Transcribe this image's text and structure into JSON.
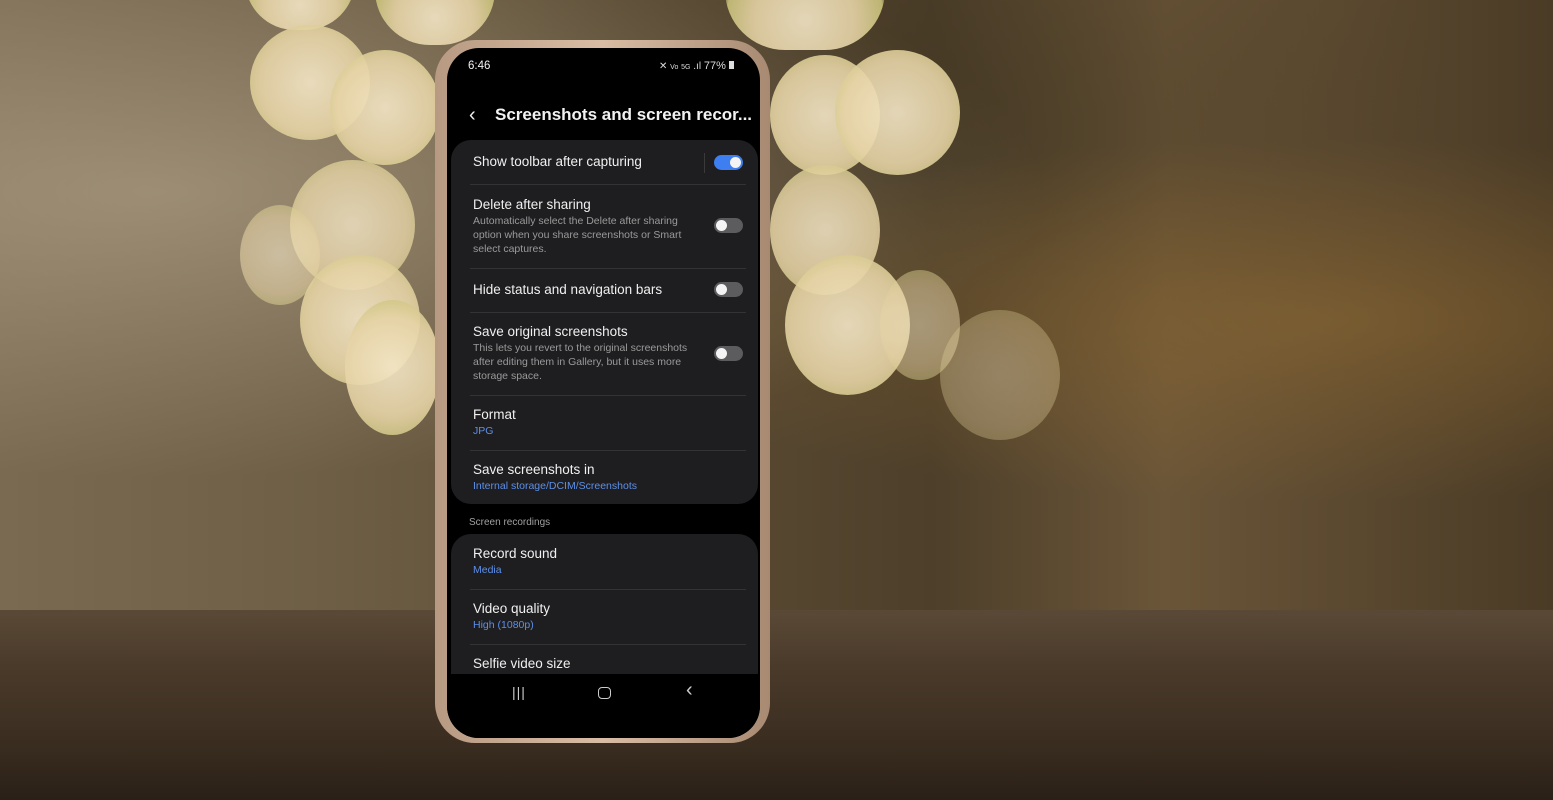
{
  "status_bar": {
    "time": "6:46",
    "icons": [
      "mute-icon",
      "volte-icon",
      "5g-icon",
      "signal-icon"
    ],
    "battery": "77%"
  },
  "header": {
    "title": "Screenshots and screen recor...",
    "back_icon": "chevron-left-icon"
  },
  "screenshots": [
    {
      "title": "Show toolbar after capturing",
      "toggle": true
    },
    {
      "title": "Delete after sharing",
      "subtitle": "Automatically select the Delete after sharing option when you share screenshots or Smart select captures.",
      "toggle": false
    },
    {
      "title": "Hide status and navigation bars",
      "toggle": false
    },
    {
      "title": "Save original screenshots",
      "subtitle": "This lets you revert to the original screenshots after editing them in Gallery, but it uses more storage space.",
      "toggle": false
    },
    {
      "title": "Format",
      "value": "JPG"
    },
    {
      "title": "Save screenshots in",
      "value": "Internal storage/DCIM/Screenshots"
    }
  ],
  "section_label": "Screen recordings",
  "recordings": [
    {
      "title": "Record sound",
      "value": "Media"
    },
    {
      "title": "Video quality",
      "value": "High (1080p)"
    },
    {
      "title": "Selfie video size"
    }
  ],
  "nav": {
    "recents": "recents-icon",
    "home": "home-icon",
    "back": "back-icon"
  },
  "colors": {
    "accent": "#3d7ef0",
    "value_text": "#5d8fe8",
    "card": "#1e1e21"
  }
}
